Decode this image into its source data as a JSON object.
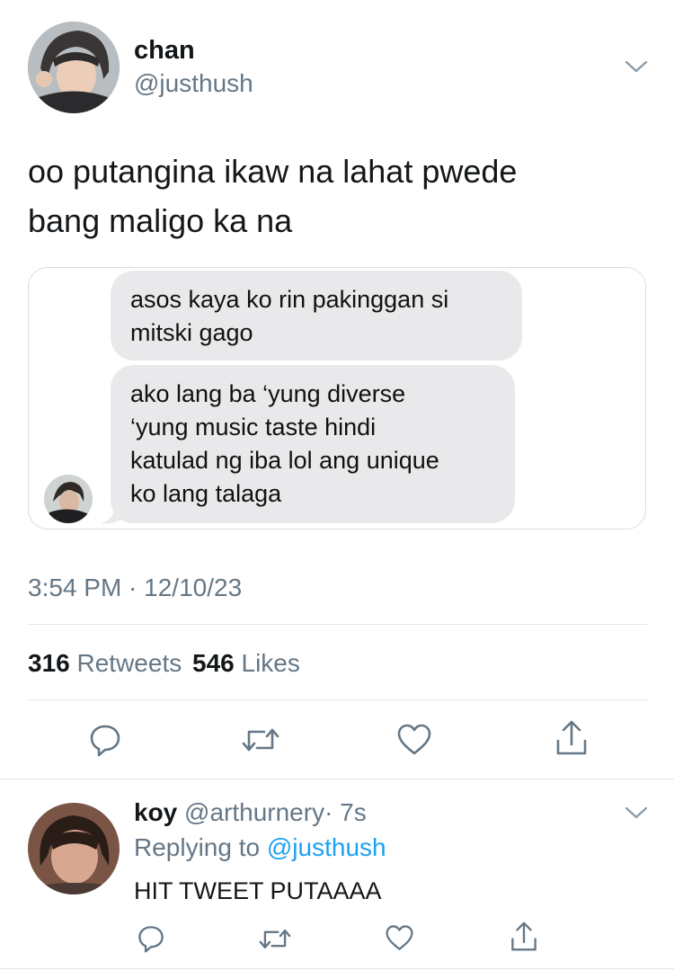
{
  "tweet": {
    "author_name": "chan",
    "author_handle": "@justhush",
    "text_line1": "oo putangina ikaw na lahat pwede",
    "text_line2": "bang maligo ka na",
    "embedded_messages": {
      "bubble1_line1": "asos kaya ko rin pakinggan si",
      "bubble1_line2": "mitski gago",
      "bubble2_line1": "ako lang ba ‘yung diverse",
      "bubble2_line2": "‘yung music taste hindi",
      "bubble2_line3": "katulad ng iba lol ang unique",
      "bubble2_line4": "ko lang talaga"
    },
    "timestamp": "3:54 PM · 12/10/23",
    "retweet_count": "316",
    "retweet_label": "Retweets",
    "like_count": "546",
    "like_label": "Likes"
  },
  "reply": {
    "author_name": "koy",
    "author_handle": "@arthurnery",
    "time_ago": "· 7s",
    "replying_prefix": "Replying to",
    "replying_handle": "@justhush",
    "text": "HIT TWEET PUTAAAA"
  },
  "icons": [
    "chevron-down-icon",
    "reply-icon",
    "retweet-icon",
    "like-icon",
    "share-icon"
  ],
  "colors": {
    "link": "#1da1f2",
    "secondary_text": "#657786",
    "bubble": "#e9e9eb",
    "divider": "#e1e8ed"
  }
}
